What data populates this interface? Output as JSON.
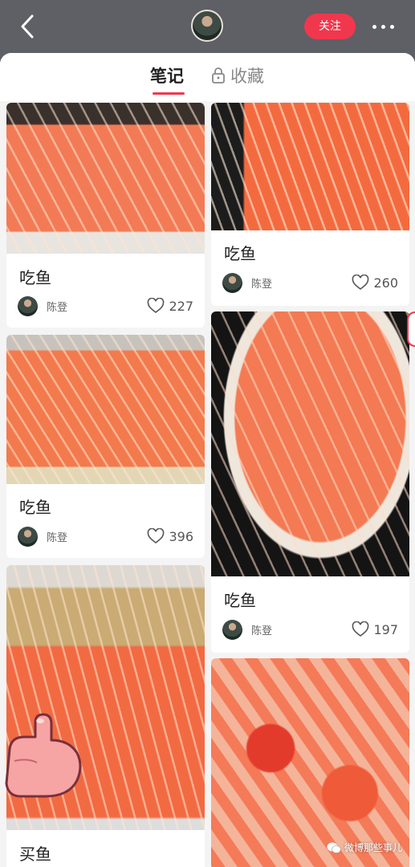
{
  "header": {
    "follow_label": "关注"
  },
  "tabs": [
    {
      "label": "笔记",
      "active": true
    },
    {
      "label": "收藏",
      "locked": true
    }
  ],
  "cards": [
    {
      "title": "吃鱼",
      "author": "陈登",
      "likes": "227"
    },
    {
      "title": "吃鱼",
      "author": "陈登",
      "likes": "260"
    },
    {
      "title": "吃鱼",
      "author": "陈登",
      "likes": "396"
    },
    {
      "title": "吃鱼",
      "author": "陈登",
      "likes": "197"
    },
    {
      "title": "买鱼"
    }
  ],
  "watermark": "微博那些事儿",
  "colors": {
    "accent": "#f1374d",
    "topbar": "#5f5f66",
    "salmon": "#f27b55"
  }
}
